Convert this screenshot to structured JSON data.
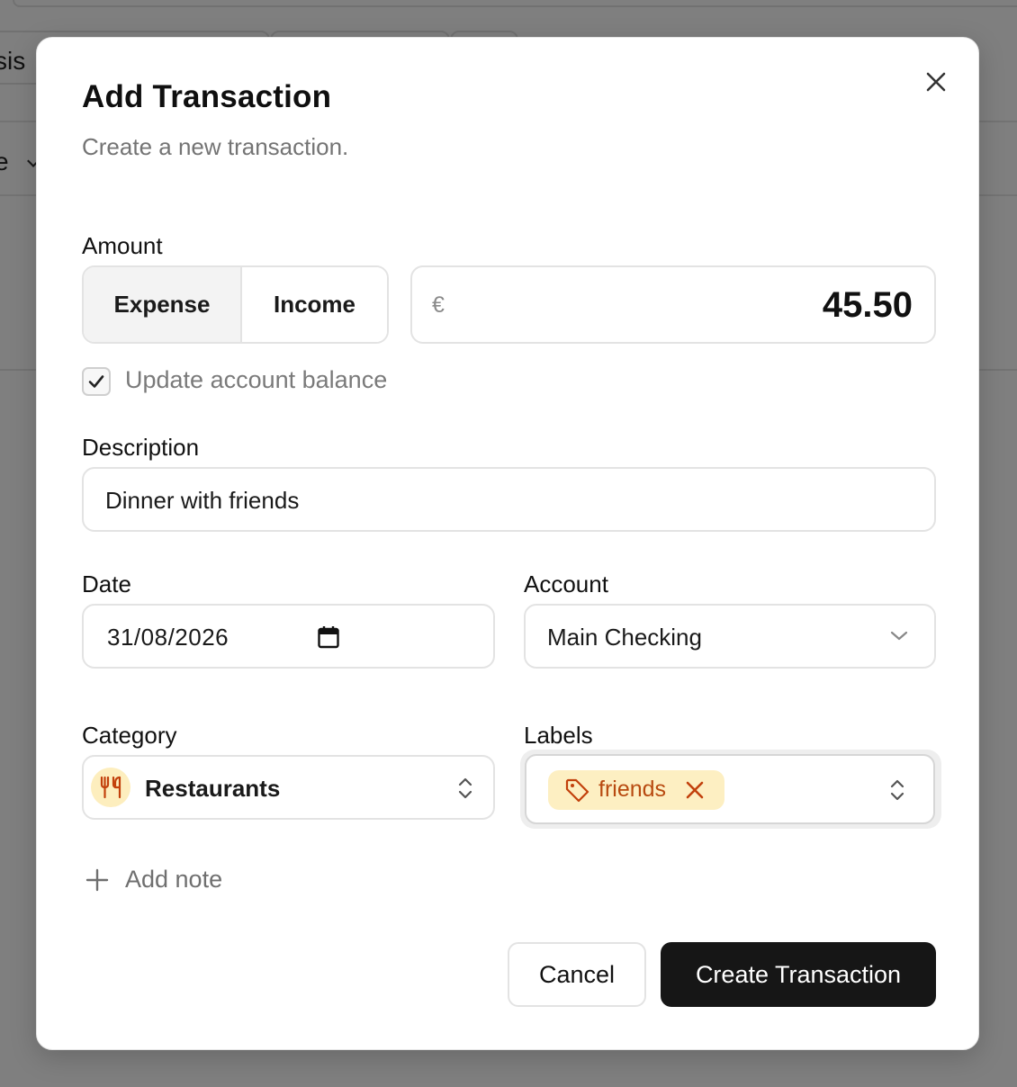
{
  "background": {
    "tab_fragment": "sis",
    "row_fragment": "e"
  },
  "dialog": {
    "title": "Add Transaction",
    "subtitle": "Create a new transaction."
  },
  "amount": {
    "label": "Amount",
    "type_options": [
      "Expense",
      "Income"
    ],
    "selected_type": "Expense",
    "currency_symbol": "€",
    "value": "45.50"
  },
  "balance_checkbox": {
    "label": "Update account balance",
    "checked": true
  },
  "description": {
    "label": "Description",
    "value": "Dinner with friends"
  },
  "date": {
    "label": "Date",
    "value": "31/08/2026"
  },
  "account": {
    "label": "Account",
    "value": "Main Checking"
  },
  "category": {
    "label": "Category",
    "value": "Restaurants",
    "icon": "utensils-icon"
  },
  "labels": {
    "label": "Labels",
    "chips": [
      "friends"
    ]
  },
  "add_note": {
    "label": "Add note"
  },
  "actions": {
    "cancel": "Cancel",
    "create": "Create Transaction"
  },
  "colors": {
    "overlay": "#808080",
    "primary_button": "#161616",
    "chip_bg": "#fdefc2",
    "chip_text": "#b84a10",
    "category_icon_bg": "#fdeebe"
  }
}
